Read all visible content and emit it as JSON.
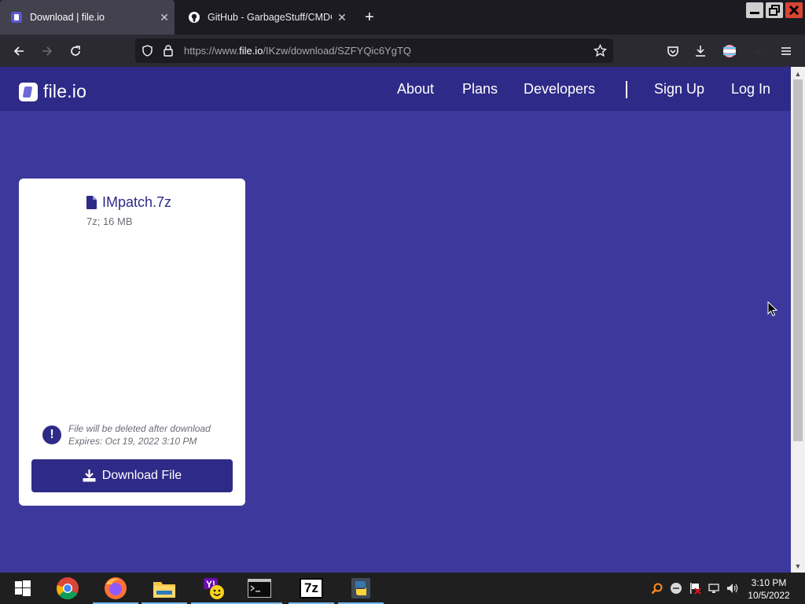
{
  "browser": {
    "tabs": [
      {
        "title": "Download | file.io",
        "active": true
      },
      {
        "title": "GitHub - GarbageStuff/CMDOnline",
        "active": false
      }
    ],
    "url_prefix": "https://www.",
    "url_domain": "file.io",
    "url_path": "/IKzw/download/SZFYQic6YgTQ"
  },
  "site": {
    "logo_text": "file.io",
    "nav": {
      "about": "About",
      "plans": "Plans",
      "developers": "Developers",
      "signup": "Sign Up",
      "login": "Log In"
    }
  },
  "file": {
    "name": "IMpatch.7z",
    "meta": "7z; 16 MB",
    "notice_line1": "File will be deleted after download",
    "notice_line2": "Expires: Oct 19, 2022 3:10 PM",
    "download_label": "Download File",
    "notice_icon_glyph": "!"
  },
  "taskbar": {
    "time": "3:10 PM",
    "date": "10/5/2022",
    "apps": [
      "start-icon",
      "chrome-icon",
      "firefox-icon",
      "file-explorer-icon",
      "yahoo-messenger-icon",
      "cmd-icon",
      "7zip-icon",
      "python-icon"
    ],
    "sevenzip_label": "7z"
  },
  "colors": {
    "page_bg": "#3d389c",
    "header_bg": "#2e2a87",
    "accent": "#2e2a87",
    "card_bg": "#ffffff"
  }
}
